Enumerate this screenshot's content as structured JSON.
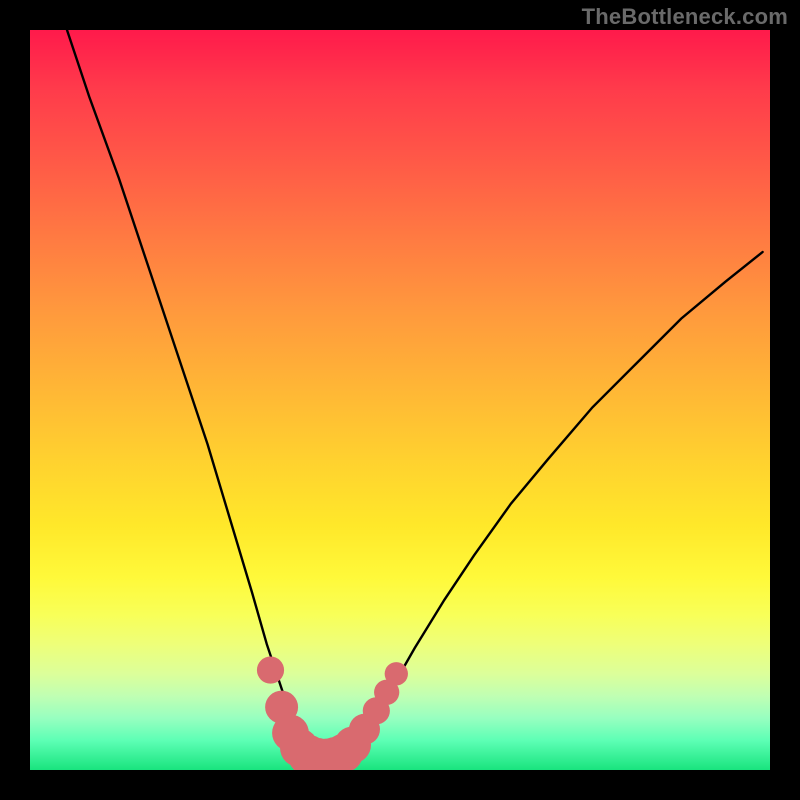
{
  "watermark": "TheBottleneck.com",
  "colors": {
    "background": "#000000",
    "curve": "#000000",
    "marker_fill": "#d96a6f",
    "gradient_top": "#ff1a4b",
    "gradient_bottom": "#19e47e"
  },
  "chart_data": {
    "type": "line",
    "title": "",
    "xlabel": "",
    "ylabel": "",
    "xlim": [
      0,
      100
    ],
    "ylim": [
      0,
      100
    ],
    "grid": false,
    "legend": false,
    "series": [
      {
        "name": "bottleneck-curve",
        "x": [
          5,
          8,
          12,
          16,
          20,
          24,
          27,
          30,
          32,
          34,
          35,
          36,
          37,
          38,
          39,
          40,
          41,
          42,
          43,
          44,
          46,
          48,
          52,
          56,
          60,
          65,
          70,
          76,
          82,
          88,
          94,
          99
        ],
        "y": [
          100,
          91,
          80,
          68,
          56,
          44,
          34,
          24,
          17,
          11,
          8,
          5.5,
          3.5,
          2.3,
          1.7,
          1.5,
          1.6,
          1.9,
          2.6,
          3.8,
          6.4,
          9.5,
          16.5,
          23,
          29,
          36,
          42,
          49,
          55,
          61,
          66,
          70
        ]
      }
    ],
    "markers": [
      {
        "x": 32.5,
        "y": 13.5,
        "r": 1.1
      },
      {
        "x": 34.0,
        "y": 8.5,
        "r": 1.4
      },
      {
        "x": 35.2,
        "y": 5.0,
        "r": 1.6
      },
      {
        "x": 36.4,
        "y": 3.0,
        "r": 1.7
      },
      {
        "x": 37.6,
        "y": 2.0,
        "r": 1.8
      },
      {
        "x": 38.8,
        "y": 1.6,
        "r": 1.8
      },
      {
        "x": 40.0,
        "y": 1.5,
        "r": 1.8
      },
      {
        "x": 41.2,
        "y": 1.7,
        "r": 1.8
      },
      {
        "x": 42.4,
        "y": 2.3,
        "r": 1.7
      },
      {
        "x": 43.6,
        "y": 3.4,
        "r": 1.6
      },
      {
        "x": 45.2,
        "y": 5.5,
        "r": 1.3
      },
      {
        "x": 46.8,
        "y": 8.0,
        "r": 1.1
      },
      {
        "x": 48.2,
        "y": 10.5,
        "r": 1.0
      },
      {
        "x": 49.5,
        "y": 13.0,
        "r": 0.9
      }
    ]
  }
}
